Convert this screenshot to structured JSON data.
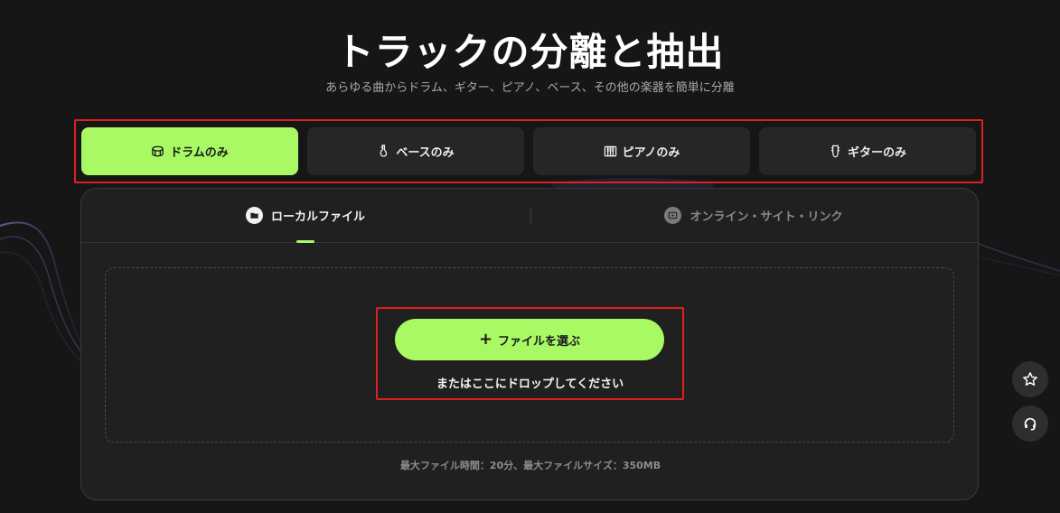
{
  "header": {
    "title": "トラックの分離と抽出",
    "subtitle": "あらゆる曲からドラム、ギター、ピアノ、ベース、その他の楽器を簡単に分離"
  },
  "mode_tabs": [
    {
      "label": "ドラムのみ",
      "icon": "drum-icon",
      "active": true
    },
    {
      "label": "ベースのみ",
      "icon": "bass-icon",
      "active": false
    },
    {
      "label": "ピアノのみ",
      "icon": "piano-icon",
      "active": false
    },
    {
      "label": "ギターのみ",
      "icon": "guitar-icon",
      "active": false
    }
  ],
  "source_tabs": [
    {
      "label": "ローカルファイル",
      "icon": "folder-icon",
      "active": true
    },
    {
      "label": "オンライン・サイト・リンク",
      "icon": "play-icon",
      "active": false
    }
  ],
  "upload": {
    "button_label": "ファイルを選ぶ",
    "drop_text": "またはここにドロップしてください"
  },
  "limits_text": "最大ファイル時間：20分、最大ファイルサイズ：350MB",
  "float_actions": [
    {
      "icon": "star-icon"
    },
    {
      "icon": "headset-icon"
    }
  ],
  "colors": {
    "accent": "#a8f964",
    "background": "#161616",
    "panel": "#202020",
    "highlight_border": "#e02020"
  }
}
